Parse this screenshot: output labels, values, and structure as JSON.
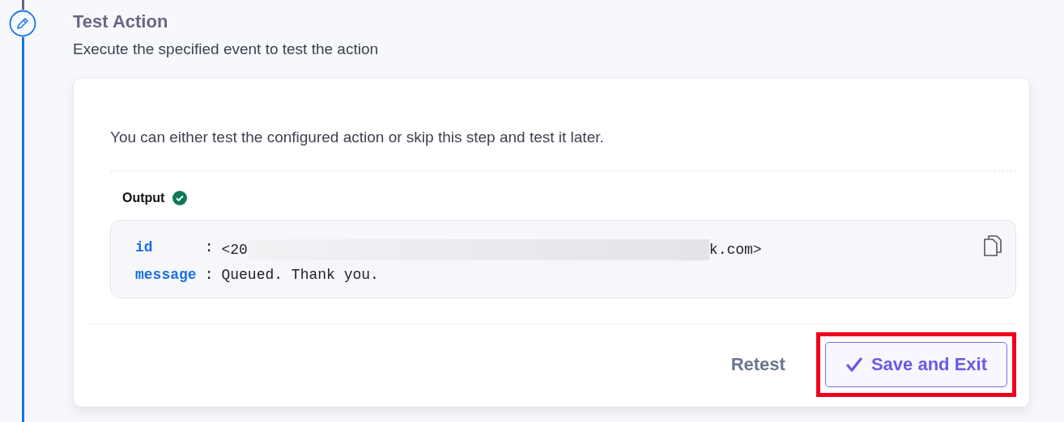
{
  "step": {
    "title": "Test Action",
    "subtitle": "Execute the specified event to test the action"
  },
  "card": {
    "intro": "You can either test the configured action or skip this step and test it later.",
    "output": {
      "label": "Output",
      "success": true,
      "fields": [
        {
          "key": "id",
          "separator": ":",
          "value_start": "<20",
          "redacted": true,
          "value_end": "k.com>"
        },
        {
          "key": "message",
          "separator": ":",
          "value_start": "Queued. Thank you."
        }
      ]
    },
    "buttons": [
      {
        "label": "Retest",
        "kind": "text"
      },
      {
        "label": "Save and Exit",
        "kind": "primary",
        "highlighted": true
      }
    ]
  }
}
